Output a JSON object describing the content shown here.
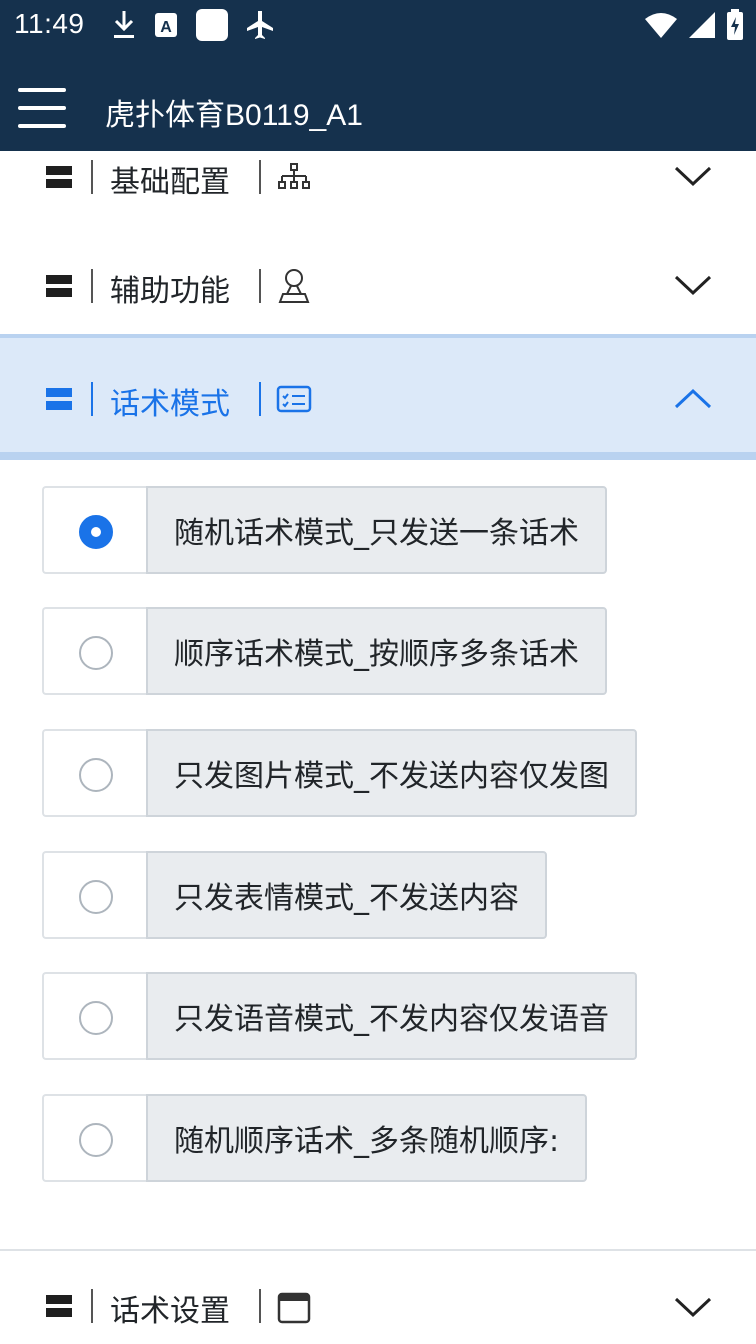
{
  "status_bar": {
    "time": "11:49",
    "left_icons": [
      "download-icon",
      "text-a-icon",
      "white-square-icon",
      "airplane-icon"
    ],
    "right_icons": [
      "wifi-icon",
      "signal-icon",
      "battery-charging-icon"
    ]
  },
  "app_bar": {
    "menu_icon": "hamburger-menu-icon",
    "title": "虎扑体育B0119_A1",
    "background": "#15314d"
  },
  "sections": [
    {
      "label": "基础配置",
      "icon": "sitemap-icon",
      "expanded": false
    },
    {
      "label": "辅助功能",
      "icon": "user-icon",
      "expanded": false
    },
    {
      "label": "话术模式",
      "icon": "id-card-icon",
      "expanded": true
    },
    {
      "label": "话术设置",
      "icon": "calendar-icon",
      "expanded": false
    }
  ],
  "options": [
    {
      "label": "随机话术模式_只发送一条话术",
      "selected": true
    },
    {
      "label": "顺序话术模式_按顺序多条话术",
      "selected": false
    },
    {
      "label": "只发图片模式_不发送内容仅发图",
      "selected": false
    },
    {
      "label": "只发表情模式_不发送内容",
      "selected": false
    },
    {
      "label": "只发语音模式_不发内容仅发语音",
      "selected": false
    },
    {
      "label": "随机顺序话术_多条随机顺序:",
      "selected": false
    }
  ],
  "colors": {
    "accent": "#1a73e8",
    "active_section_bg": "#dce9f9",
    "option_label_bg": "#e9ecef"
  }
}
